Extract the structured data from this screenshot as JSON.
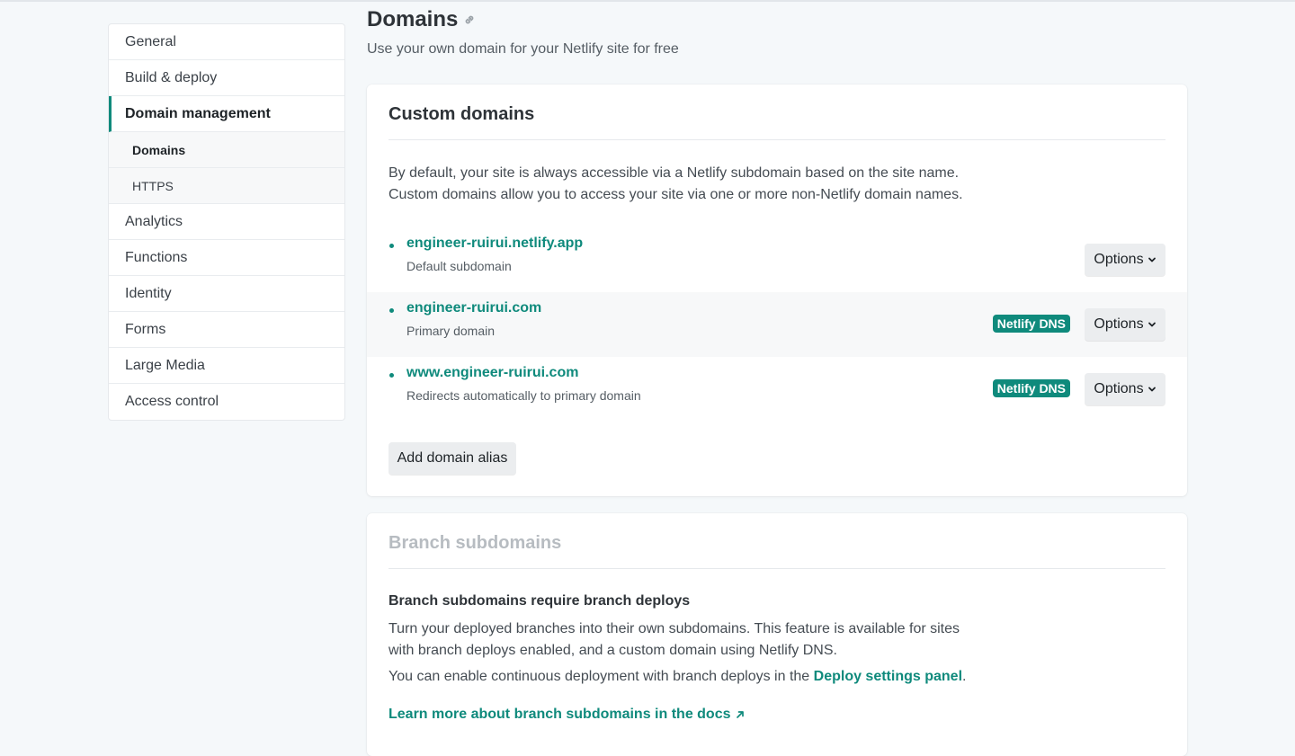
{
  "sidebar": {
    "items": [
      {
        "label": "General"
      },
      {
        "label": "Build & deploy"
      },
      {
        "label": "Domain management"
      },
      {
        "label": "Analytics"
      },
      {
        "label": "Functions"
      },
      {
        "label": "Identity"
      },
      {
        "label": "Forms"
      },
      {
        "label": "Large Media"
      },
      {
        "label": "Access control"
      }
    ],
    "subitems": [
      {
        "label": "Domains"
      },
      {
        "label": "HTTPS"
      }
    ]
  },
  "header": {
    "title": "Domains",
    "subtitle": "Use your own domain for your Netlify site for free"
  },
  "custom_domains": {
    "title": "Custom domains",
    "desc_line1": "By default, your site is always accessible via a Netlify subdomain based on the site name.",
    "desc_line2": "Custom domains allow you to access your site via one or more non-Netlify domain names.",
    "domains": [
      {
        "name": "engineer-ruirui.netlify.app",
        "note": "Default subdomain",
        "options": "Options"
      },
      {
        "name": "engineer-ruirui.com",
        "note": "Primary domain",
        "badge": "Netlify DNS",
        "options": "Options"
      },
      {
        "name": "www.engineer-ruirui.com",
        "note": "Redirects automatically to primary domain",
        "badge": "Netlify DNS",
        "options": "Options"
      }
    ],
    "add_alias_label": "Add domain alias"
  },
  "branch_subdomains": {
    "title": "Branch subdomains",
    "heading": "Branch subdomains require branch deploys",
    "text": "Turn your deployed branches into their own subdomains. This feature is available for sites with branch deploys enabled, and a custom domain using Netlify DNS.",
    "text2_prefix": "You can enable continuous deployment with branch deploys in the",
    "text2_link": "Deploy settings panel",
    "text2_suffix": ".",
    "learn_more": "Learn more about branch subdomains in the docs"
  },
  "colors": {
    "accent": "#0f8a7c",
    "background": "#f5f8fa"
  }
}
